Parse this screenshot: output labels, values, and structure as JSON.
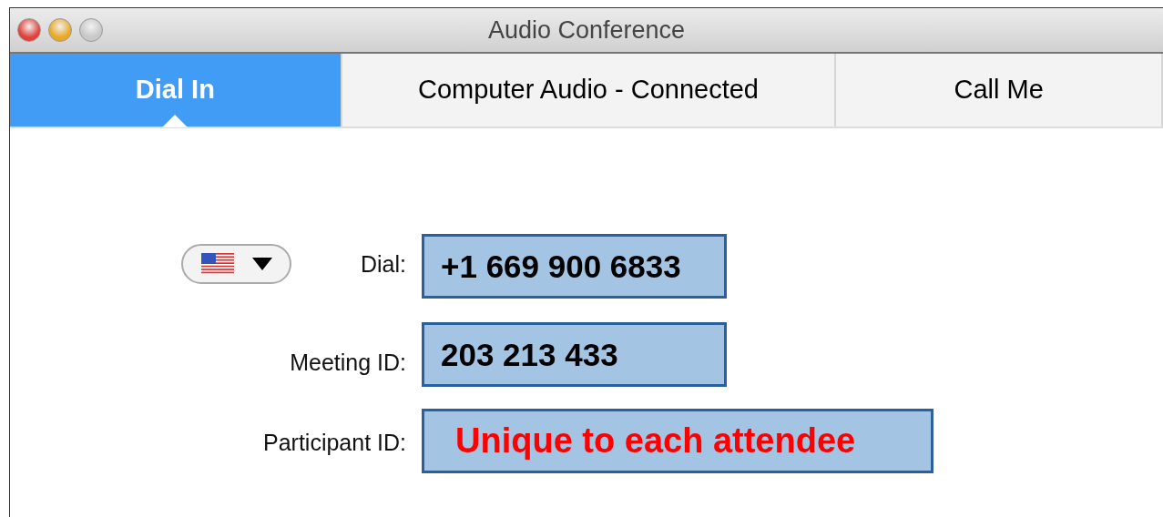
{
  "window": {
    "title": "Audio Conference"
  },
  "tabs": [
    {
      "label": "Dial In",
      "selected": true
    },
    {
      "label": "Computer Audio - Connected",
      "selected": false
    },
    {
      "label": "Call Me",
      "selected": false
    }
  ],
  "country_dropdown": {
    "kind": "us-flag"
  },
  "fields": [
    {
      "label": "Dial:",
      "value": "+1 669 900 6833",
      "kind": "number"
    },
    {
      "label": "Meeting ID:",
      "value": "203 213 433",
      "kind": "number"
    },
    {
      "label": "Participant ID:",
      "value": "Unique to each attendee",
      "kind": "note"
    }
  ]
}
